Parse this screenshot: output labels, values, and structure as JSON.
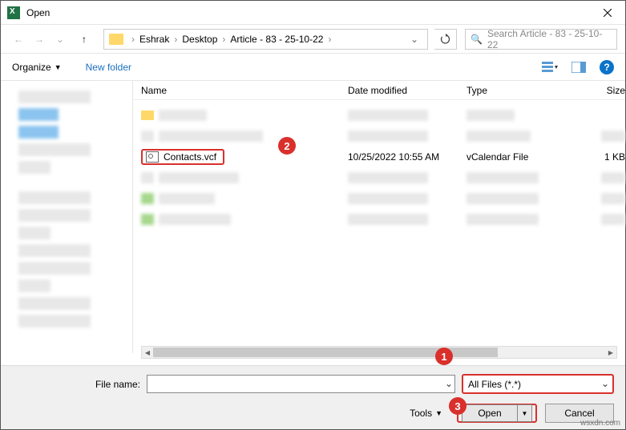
{
  "window": {
    "title": "Open"
  },
  "breadcrumb": {
    "items": [
      "Eshrak",
      "Desktop",
      "Article - 83 - 25-10-22"
    ]
  },
  "search": {
    "placeholder": "Search Article - 83 - 25-10-22"
  },
  "toolbar": {
    "organize": "Organize",
    "newfolder": "New folder"
  },
  "columns": {
    "name": "Name",
    "date": "Date modified",
    "type": "Type",
    "size": "Size"
  },
  "file": {
    "name": "Contacts.vcf",
    "date": "10/25/2022 10:55 AM",
    "type": "vCalendar File",
    "size": "1 KB"
  },
  "footer": {
    "filename_label": "File name:",
    "filename_value": "",
    "filetype": "All Files (*.*)",
    "tools": "Tools",
    "open": "Open",
    "cancel": "Cancel"
  },
  "callouts": {
    "one": "1",
    "two": "2",
    "three": "3"
  },
  "watermark": "wsxdn.com"
}
